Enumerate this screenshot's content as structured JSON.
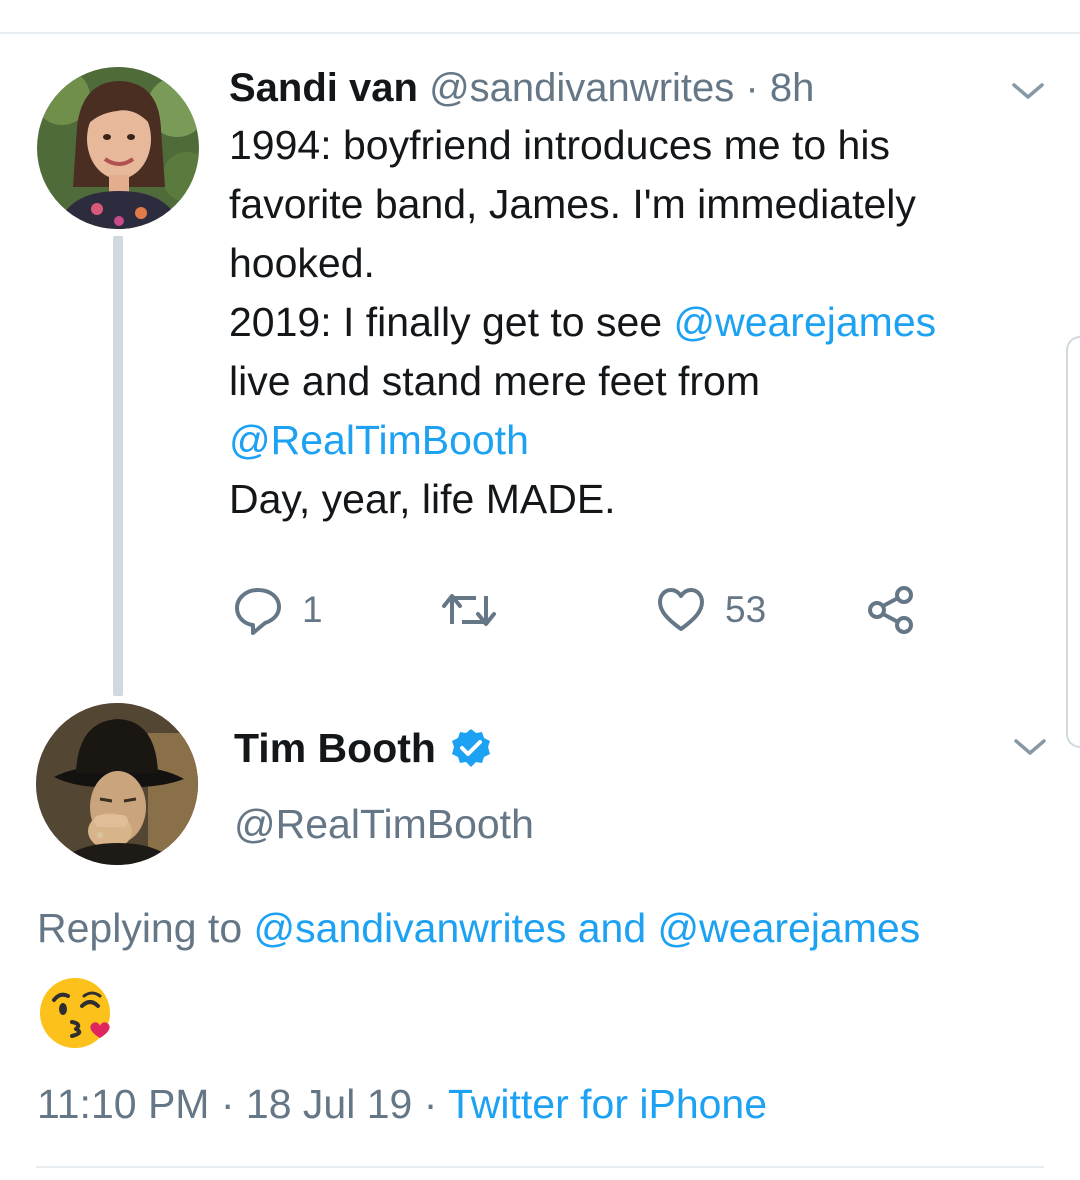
{
  "tweet1": {
    "author_name": "Sandi van",
    "handle": "@sandivanwrites",
    "separator": "·",
    "time_ago": "8h",
    "body": {
      "line1": "1994: boyfriend introduces me to his",
      "line2": "favorite band, James. I'm immediately",
      "line3": "hooked.",
      "line4_pre": "2019: I finally get to see ",
      "line4_mention": "@wearejames",
      "line5": "live and stand mere feet from",
      "line6_mention": "@RealTimBooth",
      "line7": "Day, year, life MADE."
    },
    "actions": {
      "reply_count": "1",
      "retweet_count": "",
      "like_count": "53"
    }
  },
  "tweet2": {
    "author_name": "Tim Booth",
    "verified": true,
    "handle": "@RealTimBooth",
    "replying_prefix": "Replying to ",
    "replying_mention1": "@sandivanwrites",
    "replying_and": " and ",
    "replying_mention2": "@wearejames",
    "body_emoji": "face-throwing-a-kiss",
    "time": "11:10 PM",
    "separator": " · ",
    "date": "18 Jul 19",
    "source": "Twitter for iPhone"
  },
  "colors": {
    "link": "#1da1f2",
    "muted": "#657786",
    "text": "#14171a",
    "divider": "#e6ecf0"
  }
}
